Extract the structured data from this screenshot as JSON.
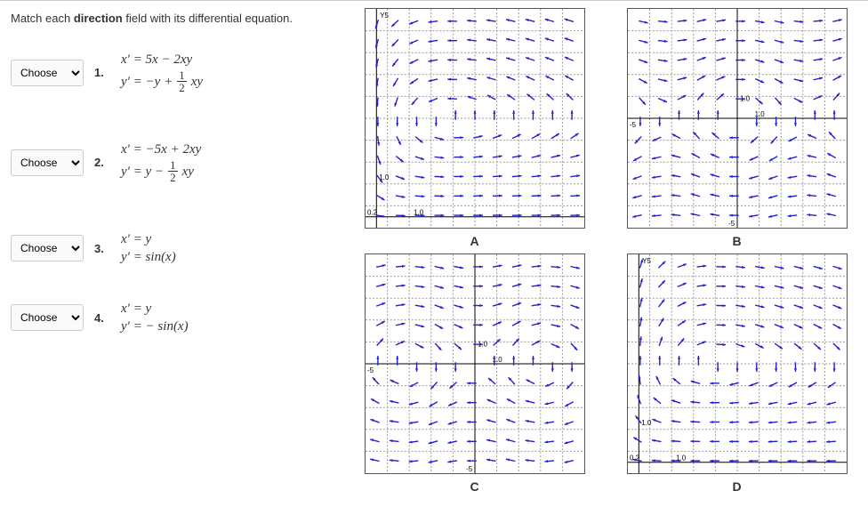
{
  "prompt_pre": "Match each ",
  "prompt_bold": "direction",
  "prompt_post": " field with its differential equation.",
  "choose_placeholder": "Choose",
  "questions": [
    {
      "num": "1.",
      "eq_x": "x′ = 5x − 2xy",
      "eq_y_pre": "y′ = −y + ",
      "eq_y_frac_num": "1",
      "eq_y_frac_den": "2",
      "eq_y_post": " xy"
    },
    {
      "num": "2.",
      "eq_x": "x′ = −5x + 2xy",
      "eq_y_pre": "y′ = y − ",
      "eq_y_frac_num": "1",
      "eq_y_frac_den": "2",
      "eq_y_post": " xy"
    },
    {
      "num": "3.",
      "eq_x": "x′ = y",
      "eq_y_pre": "y′ = sin(x)",
      "eq_y_frac_num": "",
      "eq_y_frac_den": "",
      "eq_y_post": ""
    },
    {
      "num": "4.",
      "eq_x": "x′ = y",
      "eq_y_pre": "y′ = − sin(x)",
      "eq_y_frac_num": "",
      "eq_y_frac_den": "",
      "eq_y_post": ""
    }
  ],
  "plots": [
    {
      "label": "A",
      "variant": "spiral",
      "axis_x": 0.05,
      "axis_y": 0.95,
      "tick_x": "1.0",
      "tick_y": "1.0",
      "corner_x": "0.2",
      "axis_label_y": "Y",
      "tick_side_x": 0.22,
      "tick_side_y": 0.78
    },
    {
      "label": "B",
      "variant": "cross",
      "axis_x": 0.5,
      "axis_y": 0.5,
      "tick_x": "1.0",
      "tick_y": "1.0",
      "corner_left": "-5",
      "corner_bottom": "-5",
      "tick_side_x": 0.58,
      "tick_side_y": 0.42
    },
    {
      "label": "C",
      "variant": "sinewave",
      "axis_x": 0.5,
      "axis_y": 0.5,
      "tick_x": "1.0",
      "tick_y": "1.0",
      "corner_left": "-5",
      "corner_bottom": "-5",
      "tick_side_x": 0.58,
      "tick_side_y": 0.42
    },
    {
      "label": "D",
      "variant": "spiral2",
      "axis_x": 0.05,
      "axis_y": 0.95,
      "tick_x": "1.0",
      "tick_y": "1.0",
      "corner_x": "0.2",
      "axis_label_y": "Y",
      "tick_side_x": 0.22,
      "tick_side_y": 0.78
    }
  ],
  "chart_data": [
    {
      "label": "A",
      "type": "direction-field",
      "system": {
        "xprime": "5x - 2xy",
        "yprime": "-y + 0.5xy"
      },
      "x_range": [
        0,
        5
      ],
      "y_range": [
        0,
        5
      ],
      "axes": {
        "origin": "bottom-left",
        "ticks": [
          1.0
        ]
      },
      "description": "Lotka-Volterra style closed/spiral-like orbits in the first quadrant."
    },
    {
      "label": "B",
      "type": "direction-field",
      "system_candidate": {
        "xprime": "y",
        "yprime": "-sin(x)"
      },
      "x_range": [
        -5,
        5
      ],
      "y_range": [
        -5,
        5
      ],
      "axes": {
        "origin": "center",
        "ticks": [
          1.0,
          -5
        ]
      },
      "description": "Pendulum-like flow with leftward/rightward bands symmetric about x-axis."
    },
    {
      "label": "C",
      "type": "direction-field",
      "system_candidate": {
        "xprime": "y",
        "yprime": "sin(x)"
      },
      "x_range": [
        -5,
        5
      ],
      "y_range": [
        -5,
        5
      ],
      "axes": {
        "origin": "center",
        "ticks": [
          1.0,
          -5
        ]
      },
      "description": "Rightward flow in upper half, leftward in lower half, wavy separatrices."
    },
    {
      "label": "D",
      "type": "direction-field",
      "system": {
        "xprime": "-5x + 2xy",
        "yprime": "y - 0.5xy"
      },
      "x_range": [
        0,
        5
      ],
      "y_range": [
        0,
        5
      ],
      "axes": {
        "origin": "bottom-left",
        "ticks": [
          1.0
        ]
      },
      "description": "Reverse-orientation Lotka-Volterra closed orbits in first quadrant."
    }
  ]
}
